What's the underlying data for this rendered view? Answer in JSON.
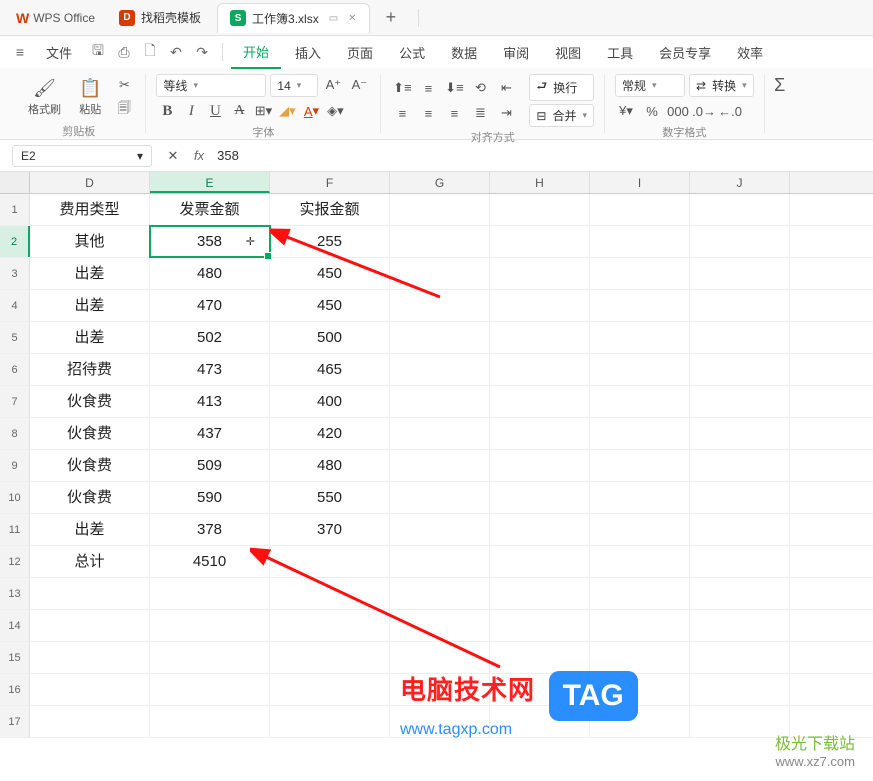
{
  "app": {
    "name": "WPS Office"
  },
  "tabs": [
    {
      "icon": "D",
      "label": "找稻壳模板"
    },
    {
      "icon": "S",
      "label": "工作簿3.xlsx",
      "active": true
    }
  ],
  "menu": {
    "file": "文件",
    "items": [
      "开始",
      "插入",
      "页面",
      "公式",
      "数据",
      "审阅",
      "视图",
      "工具",
      "会员专享",
      "效率"
    ],
    "active": "开始"
  },
  "ribbon": {
    "clipboard": {
      "format_painter": "格式刷",
      "paste": "粘贴",
      "label": "剪贴板"
    },
    "font": {
      "family": "等线",
      "size": "14",
      "label": "字体"
    },
    "align": {
      "wrap": "换行",
      "merge": "合并",
      "label": "对齐方式"
    },
    "number": {
      "format": "常规",
      "convert": "转换",
      "label": "数字格式"
    }
  },
  "formulabar": {
    "cell_ref": "E2",
    "value": "358"
  },
  "columns": [
    "D",
    "E",
    "F",
    "G",
    "H",
    "I",
    "J"
  ],
  "selected_col": "E",
  "selected_row": 2,
  "rows": [
    {
      "n": 1,
      "d": "费用类型",
      "e": "发票金额",
      "f": "实报金额"
    },
    {
      "n": 2,
      "d": "其他",
      "e": "358",
      "f": "255"
    },
    {
      "n": 3,
      "d": "出差",
      "e": "480",
      "f": "450"
    },
    {
      "n": 4,
      "d": "出差",
      "e": "470",
      "f": "450"
    },
    {
      "n": 5,
      "d": "出差",
      "e": "502",
      "f": "500"
    },
    {
      "n": 6,
      "d": "招待费",
      "e": "473",
      "f": "465"
    },
    {
      "n": 7,
      "d": "伙食费",
      "e": "413",
      "f": "400"
    },
    {
      "n": 8,
      "d": "伙食费",
      "e": "437",
      "f": "420"
    },
    {
      "n": 9,
      "d": "伙食费",
      "e": "509",
      "f": "480"
    },
    {
      "n": 10,
      "d": "伙食费",
      "e": "590",
      "f": "550"
    },
    {
      "n": 11,
      "d": "出差",
      "e": "378",
      "f": "370"
    },
    {
      "n": 12,
      "d": "总计",
      "e": "4510",
      "f": ""
    },
    {
      "n": 13,
      "d": "",
      "e": "",
      "f": ""
    },
    {
      "n": 14,
      "d": "",
      "e": "",
      "f": ""
    },
    {
      "n": 15,
      "d": "",
      "e": "",
      "f": ""
    },
    {
      "n": 16,
      "d": "",
      "e": "",
      "f": ""
    },
    {
      "n": 17,
      "d": "",
      "e": "",
      "f": ""
    }
  ],
  "watermark": {
    "site1_name": "电脑技术网",
    "site1_url": "www.tagxp.com",
    "tag": "TAG",
    "site2_name": "极光下载站",
    "site2_url": "www.xz7.com"
  }
}
